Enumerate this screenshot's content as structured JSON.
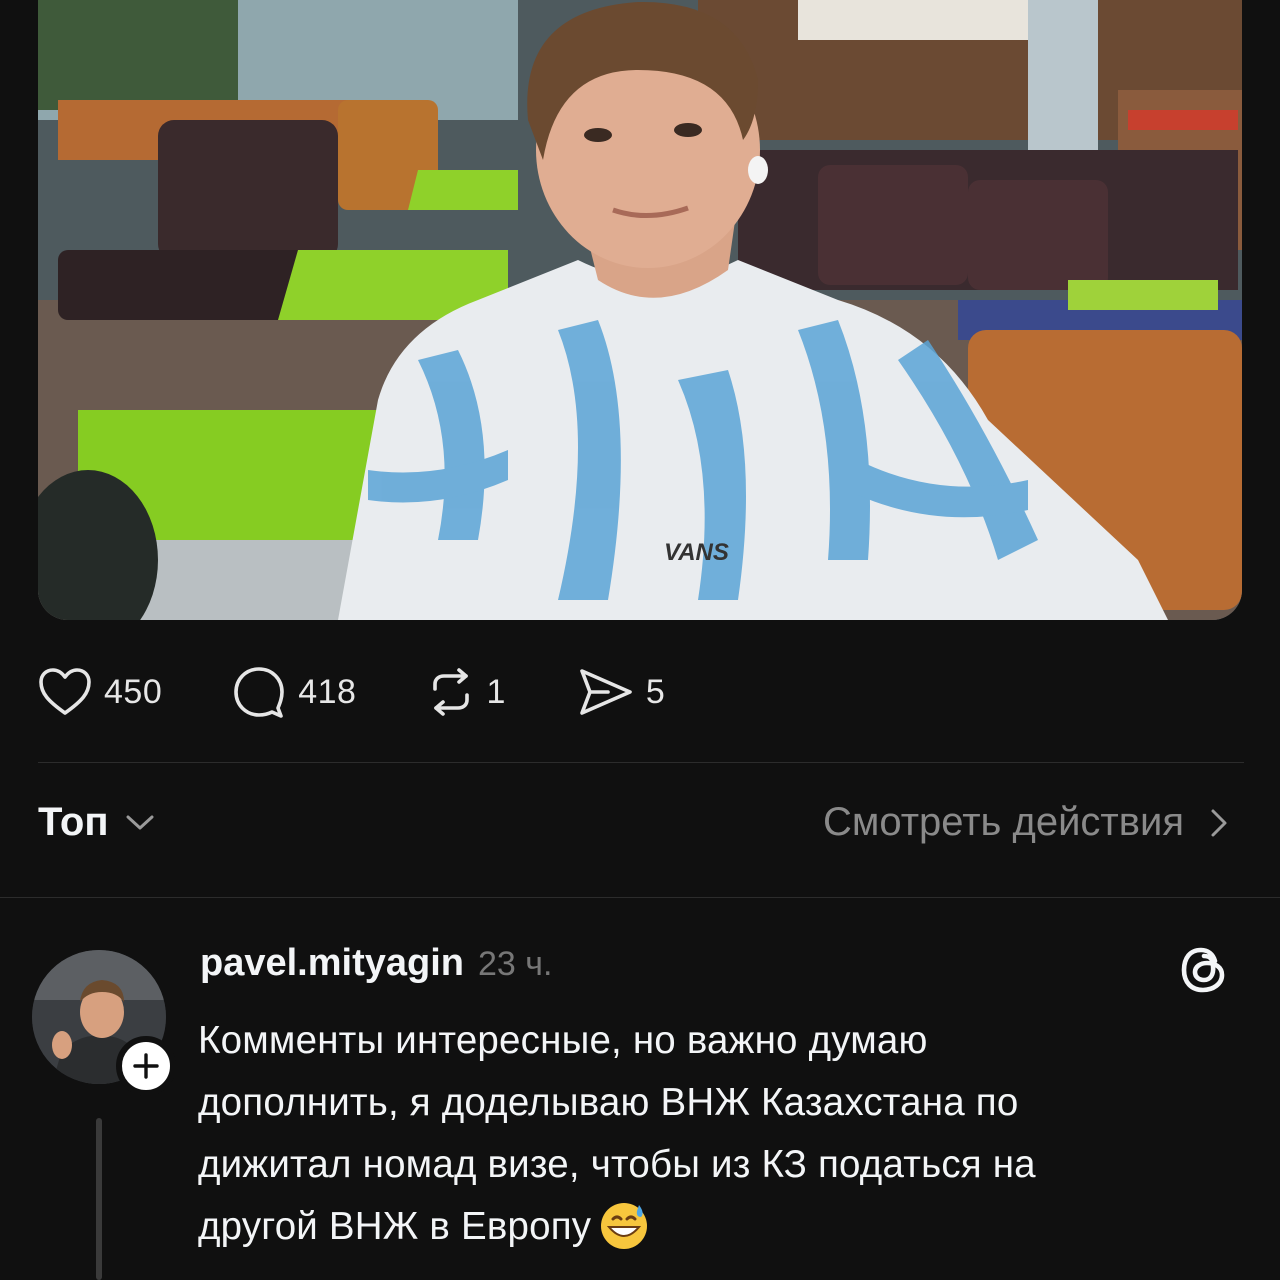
{
  "post": {
    "photo_subject": "",
    "shirt_logo": "VANS"
  },
  "actions": {
    "like": {
      "icon": "heart-icon",
      "count": "450"
    },
    "comment": {
      "icon": "comment-bubble-icon",
      "count": "418"
    },
    "repost": {
      "icon": "repost-icon",
      "count": "1"
    },
    "share": {
      "icon": "send-icon",
      "count": "5"
    }
  },
  "sort": {
    "label": "Топ",
    "icon": "chevron-down-icon",
    "view_activity": "Смотреть действия",
    "view_activity_icon": "chevron-right-icon"
  },
  "comment": {
    "username": "pavel.mityagin",
    "timestamp": "23 ч.",
    "avatar_badge_icon": "plus-icon",
    "platform_icon": "threads-logo-icon",
    "lines": [
      "Комменты интересные, но важно думаю",
      "дополнить, я доделываю ВНЖ Казахстана по",
      "дижитал номад визе, чтобы из КЗ податься на",
      "другой ВНЖ в Европу"
    ],
    "emoji": "grinning-face-with-sweat-emoji"
  },
  "colors": {
    "background": "#101010",
    "text": "#f3f5f7",
    "muted": "#8a8a8a",
    "divider": "#2c2c2c"
  }
}
